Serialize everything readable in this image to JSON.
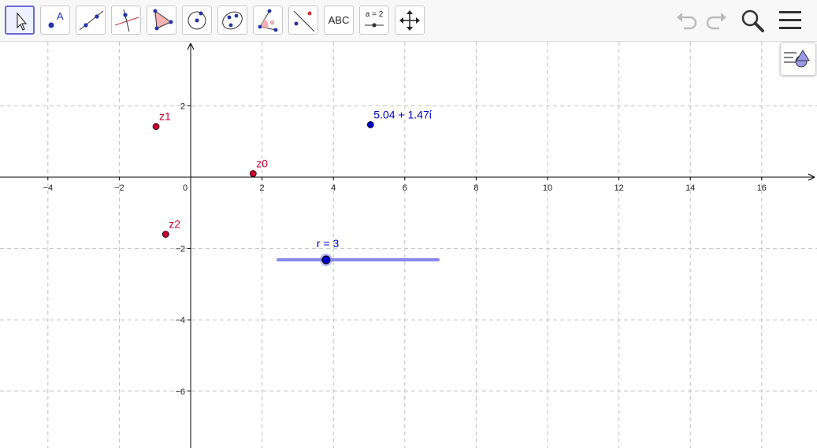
{
  "toolbar": {
    "tools": [
      {
        "name": "move-tool",
        "label": ""
      },
      {
        "name": "point-tool",
        "label": ""
      },
      {
        "name": "line-tool",
        "label": ""
      },
      {
        "name": "perpendicular-line-tool",
        "label": ""
      },
      {
        "name": "polygon-tool",
        "label": ""
      },
      {
        "name": "circle-tool",
        "label": ""
      },
      {
        "name": "ellipse-tool",
        "label": ""
      },
      {
        "name": "angle-tool",
        "label": ""
      },
      {
        "name": "reflect-tool",
        "label": ""
      },
      {
        "name": "text-tool",
        "label": "ABC"
      },
      {
        "name": "slider-tool",
        "label": "a = 2"
      },
      {
        "name": "move-graphics-view-tool",
        "label": ""
      }
    ],
    "undo_icon": "undo-icon",
    "redo_icon": "redo-icon",
    "search_icon": "search-icon",
    "menu_icon": "hamburger-menu-icon"
  },
  "graphics": {
    "x_ticks": [
      "−4",
      "−2",
      "0",
      "2",
      "4",
      "6",
      "8",
      "10",
      "12",
      "14",
      "16"
    ],
    "y_ticks": [
      "2",
      "−2",
      "−4",
      "−6"
    ],
    "points": [
      {
        "name": "z0",
        "label": "z0",
        "x": 1.75,
        "y": 0.1,
        "color": "#cc0033"
      },
      {
        "name": "z1",
        "label": "z1",
        "x": -0.97,
        "y": 1.42,
        "color": "#cc0033"
      },
      {
        "name": "z2",
        "label": "z2",
        "x": -0.7,
        "y": -1.6,
        "color": "#cc0033"
      },
      {
        "name": "result",
        "label": "5.04 + 1.47ί",
        "x": 5.04,
        "y": 1.47,
        "color": "#0000cc"
      }
    ],
    "slider": {
      "label": "r = 3",
      "value": 3,
      "min": 0,
      "max": 10,
      "color": "#8888ee"
    },
    "colors": {
      "axis": "#000000",
      "grid": "#c0c0c0",
      "red": "#cc0033",
      "blue": "#0000cc"
    }
  },
  "stylebar": {
    "icon": "style-bar-toggle-icon"
  }
}
